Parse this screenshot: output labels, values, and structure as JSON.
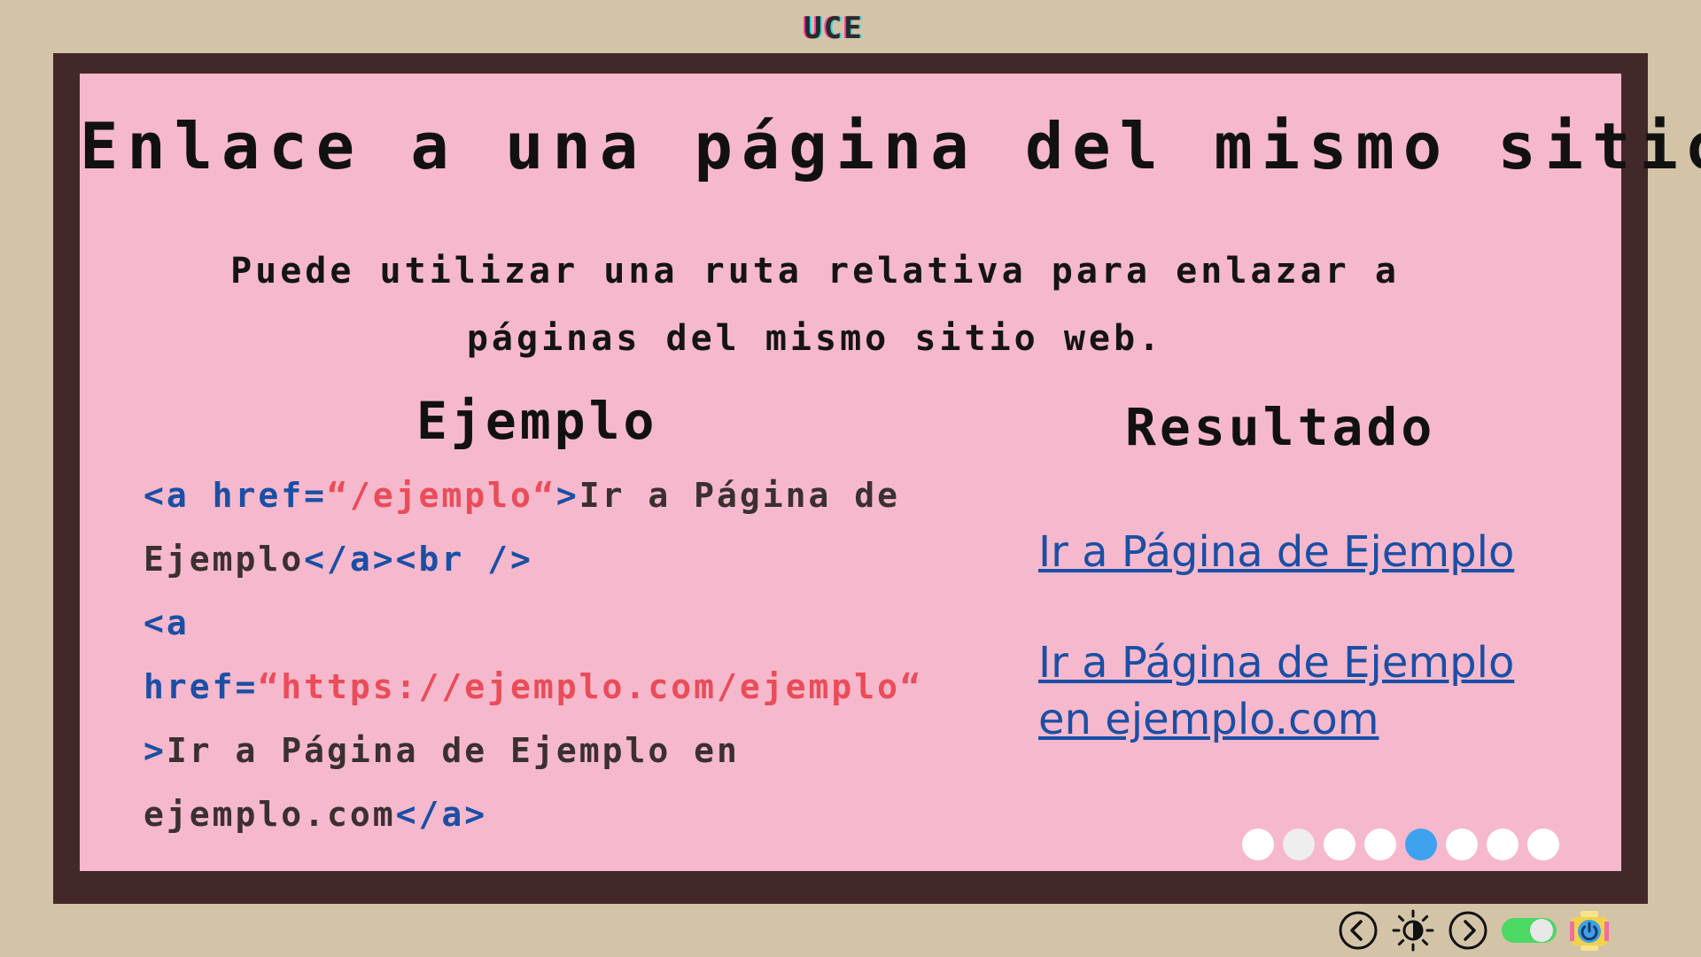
{
  "brand": "UCE",
  "slide": {
    "title": "Enlace a una página del mismo sitio",
    "intro_line1": "Puede utilizar una ruta relativa para enlazar a",
    "intro_line2": "páginas del mismo sitio web.",
    "example_heading": "Ejemplo",
    "result_heading": "Resultado",
    "code": {
      "l1_tag_open": "<a href=",
      "l1_str": "“/ejemplo“",
      "l1_gt": ">",
      "l1_txt": "Ir a Página de",
      "l2_txt": "Ejemplo",
      "l2_tag": "</a><br />",
      "l3_tag": "<a",
      "l4_attr": "href=",
      "l4_str": "“https://ejemplo.com/ejemplo“",
      "l5_gt": ">",
      "l5_txt": "Ir a Página de Ejemplo en",
      "l6_txt": "ejemplo.com",
      "l6_tag": "</a>"
    },
    "result_link1": "Ir a Página de Ejemplo",
    "result_link2_line1": "Ir a Página de Ejemplo",
    "result_link2_line2": "en ejemplo.com"
  },
  "pagination": {
    "total": 8,
    "active_index": 4
  },
  "controls": [
    {
      "name": "prev-slide-button",
      "icon": "chevron-left-icon"
    },
    {
      "name": "theme-toggle-button",
      "icon": "sun-icon"
    },
    {
      "name": "next-slide-button",
      "icon": "chevron-right-icon"
    },
    {
      "name": "mode-switch",
      "icon": "toggle-icon",
      "state": "on"
    },
    {
      "name": "power-button",
      "icon": "power-icon"
    }
  ],
  "colors": {
    "background": "#d3c4a8",
    "frame": "#43282a",
    "slide": "#f6b8cc",
    "tag": "#1a4fa5",
    "string": "#ea4c58",
    "active_dot": "#3fa2ee",
    "toggle_on": "#4cd964"
  }
}
